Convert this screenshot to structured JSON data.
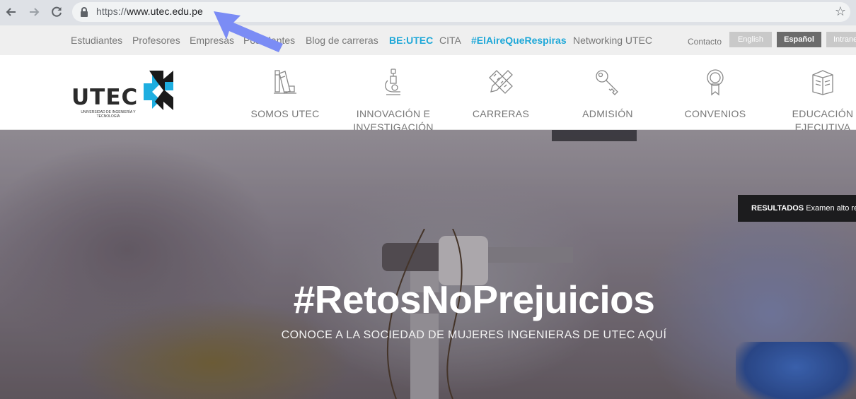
{
  "browser": {
    "url_scheme": "https://",
    "url_host": "www.utec.edu.pe",
    "back_icon": "arrow-left-icon",
    "forward_icon": "arrow-right-icon",
    "reload_icon": "reload-icon",
    "bookmark_icon": "star-icon"
  },
  "topbar": {
    "links": [
      {
        "label": "Estudiantes"
      },
      {
        "label": "Profesores"
      },
      {
        "label": "Empresas"
      },
      {
        "label": "Postulantes"
      },
      {
        "label": "Blog de carreras"
      },
      {
        "label": "BE:UTEC"
      },
      {
        "label": "CITA"
      },
      {
        "label": "#ElAireQueRespiras"
      },
      {
        "label": "Networking UTEC"
      }
    ],
    "contact": "Contacto",
    "lang_english": "English",
    "lang_spanish": "Español",
    "intranet": "Intranet"
  },
  "header": {
    "logo_word": "UTEC",
    "logo_sub": "UNIVERSIDAD DE INGENIERÍA Y TECNOLOGÍA",
    "menu": [
      {
        "label": "SOMOS UTEC",
        "icon": "books-icon"
      },
      {
        "label": "INNOVACIÓN E INVESTIGACIÓN",
        "icon": "microscope-icon"
      },
      {
        "label": "CARRERAS",
        "icon": "ruler-pencil-icon"
      },
      {
        "label": "ADMISIÓN",
        "icon": "key-icon"
      },
      {
        "label": "CONVENIOS",
        "icon": "award-ribbon-icon"
      },
      {
        "label": "EDUCACIÓN EJECUTIVA",
        "icon": "book-icon"
      }
    ]
  },
  "hero": {
    "title": "#RetosNoPrejuicios",
    "subtitle": "CONOCE A LA SOCIEDAD DE MUJERES INGENIERAS DE UTEC AQUÍ",
    "badge_strong": "RESULTADOS",
    "badge_text": "Examen alto rendimiento"
  },
  "colors": {
    "accent": "#1fa8d8",
    "annotation_arrow": "#7b8cf5",
    "logo_blue": "#1eaee0"
  }
}
